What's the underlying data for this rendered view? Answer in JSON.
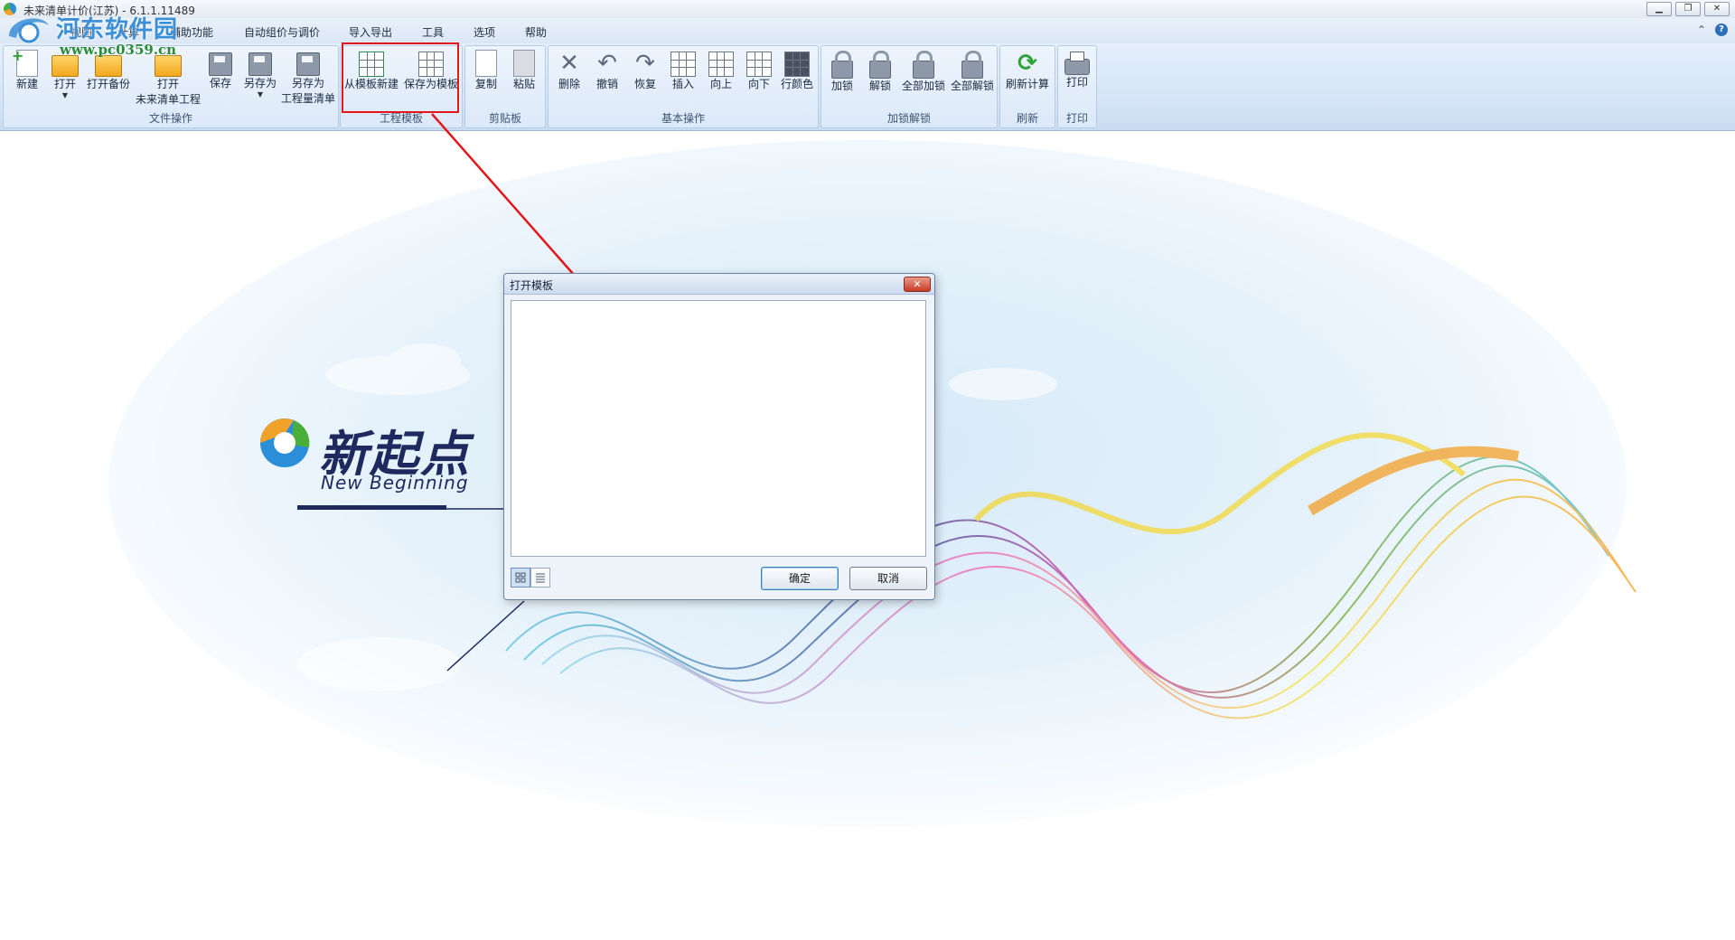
{
  "window": {
    "title": "未来清单计价(江苏) - 6.1.1.11489"
  },
  "watermark": {
    "site_name": "河东软件园",
    "url": "www.pc0359.cn"
  },
  "menubar": {
    "items": [
      "视图",
      "计算",
      "辅助功能",
      "自动组价与调价",
      "导入导出",
      "工具",
      "选项",
      "帮助"
    ]
  },
  "ribbon": {
    "groups": [
      {
        "label": "文件操作",
        "buttons": [
          "新建",
          "打开",
          "打开备份",
          "打开\n未来清单工程",
          "保存",
          "另存为",
          "另存为\n工程量清单"
        ]
      },
      {
        "label": "工程模板",
        "buttons": [
          "从模板新建",
          "保存为模板"
        ]
      },
      {
        "label": "剪贴板",
        "buttons": [
          "复制",
          "粘贴"
        ]
      },
      {
        "label": "基本操作",
        "buttons": [
          "删除",
          "撤销",
          "恢复",
          "插入",
          "向上",
          "向下",
          "行颜色"
        ]
      },
      {
        "label": "加锁解锁",
        "buttons": [
          "加锁",
          "解锁",
          "全部加锁",
          "全部解锁"
        ]
      },
      {
        "label": "刷新",
        "buttons": [
          "刷新计算"
        ]
      },
      {
        "label": "打印",
        "buttons": [
          "打印"
        ]
      }
    ]
  },
  "dialog": {
    "title": "打开模板",
    "ok_label": "确定",
    "cancel_label": "取消"
  },
  "brand": {
    "name_cn": "新起点",
    "name_en": "New Beginning"
  },
  "colors": {
    "highlight_red": "#e2161b",
    "brand_navy": "#1e2a5e",
    "ribbon_bg": "#d3e3f6"
  }
}
